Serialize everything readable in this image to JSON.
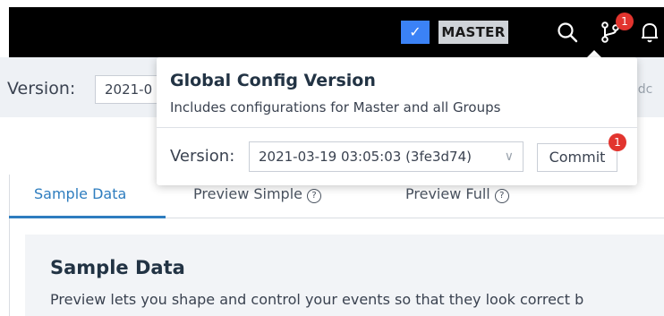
{
  "header": {
    "master_check_icon": "check-icon",
    "master_label": "MASTER",
    "branch_badge": "1",
    "colors": {
      "background": "#000000",
      "accent": "#3b82f6",
      "badge": "#e2342e"
    }
  },
  "version_bar": {
    "label": "Version:",
    "select_value": "2021-0",
    "right_text": "y dc"
  },
  "popover": {
    "title": "Global Config Version",
    "subtitle": "Includes configurations for Master and all Groups",
    "version_label": "Version:",
    "version_value": "2021-03-19 03:05:03 (3fe3d74)",
    "commit_label": "Commit",
    "commit_badge": "1"
  },
  "tabs": [
    {
      "label": "Sample Data",
      "active": true
    },
    {
      "label": "Preview Simple",
      "help_icon": "?"
    },
    {
      "label": "Preview Full",
      "help_icon": "?"
    }
  ],
  "card": {
    "title": "Sample Data",
    "text": "Preview lets you shape and control your events so that they look correct b"
  }
}
